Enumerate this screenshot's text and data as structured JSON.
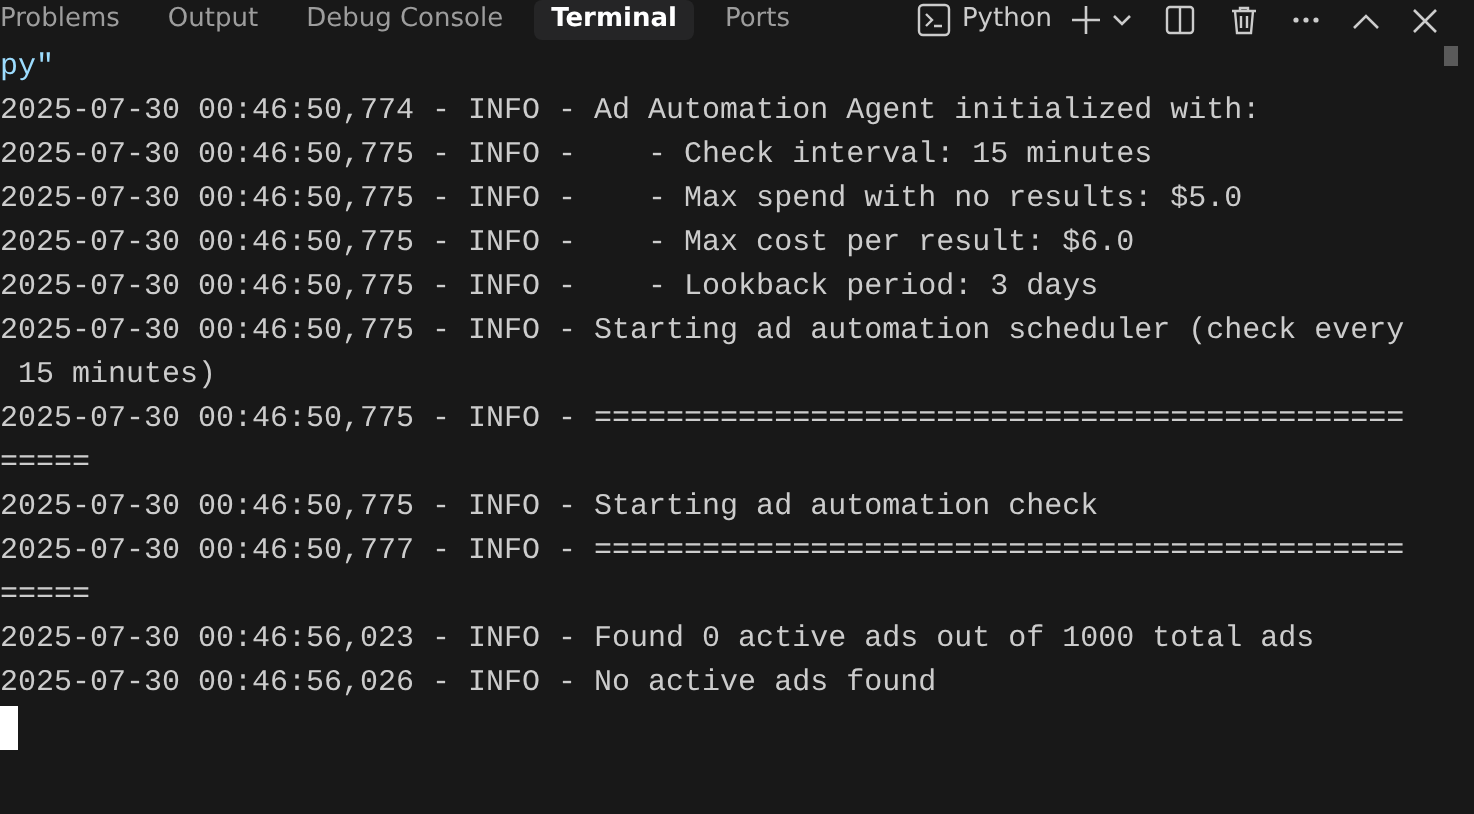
{
  "tabs": [
    {
      "label": "Problems",
      "selected": false
    },
    {
      "label": "Output",
      "selected": false
    },
    {
      "label": "Debug Console",
      "selected": false
    },
    {
      "label": "Terminal",
      "selected": true
    },
    {
      "label": "Ports",
      "selected": false
    }
  ],
  "terminal_profile": {
    "label": "Python"
  },
  "terminal_lines": [
    {
      "kind": "path",
      "text": "py\""
    },
    {
      "kind": "log",
      "text": "2025-07-30 00:46:50,774 - INFO - Ad Automation Agent initialized with:"
    },
    {
      "kind": "log",
      "text": "2025-07-30 00:46:50,775 - INFO -    - Check interval: 15 minutes"
    },
    {
      "kind": "log",
      "text": "2025-07-30 00:46:50,775 - INFO -    - Max spend with no results: $5.0"
    },
    {
      "kind": "log",
      "text": "2025-07-30 00:46:50,775 - INFO -    - Max cost per result: $6.0"
    },
    {
      "kind": "log",
      "text": "2025-07-30 00:46:50,775 - INFO -    - Lookback period: 3 days"
    },
    {
      "kind": "log",
      "text": "2025-07-30 00:46:50,775 - INFO - Starting ad automation scheduler (check every"
    },
    {
      "kind": "log",
      "text": " 15 minutes)"
    },
    {
      "kind": "log",
      "text": "2025-07-30 00:46:50,775 - INFO - ============================================="
    },
    {
      "kind": "log",
      "text": "====="
    },
    {
      "kind": "log",
      "text": "2025-07-30 00:46:50,775 - INFO - Starting ad automation check"
    },
    {
      "kind": "log",
      "text": "2025-07-30 00:46:50,777 - INFO - ============================================="
    },
    {
      "kind": "log",
      "text": "====="
    },
    {
      "kind": "log",
      "text": "2025-07-30 00:46:56,023 - INFO - Found 0 active ads out of 1000 total ads"
    },
    {
      "kind": "log",
      "text": "2025-07-30 00:46:56,026 - INFO - No active ads found"
    }
  ]
}
